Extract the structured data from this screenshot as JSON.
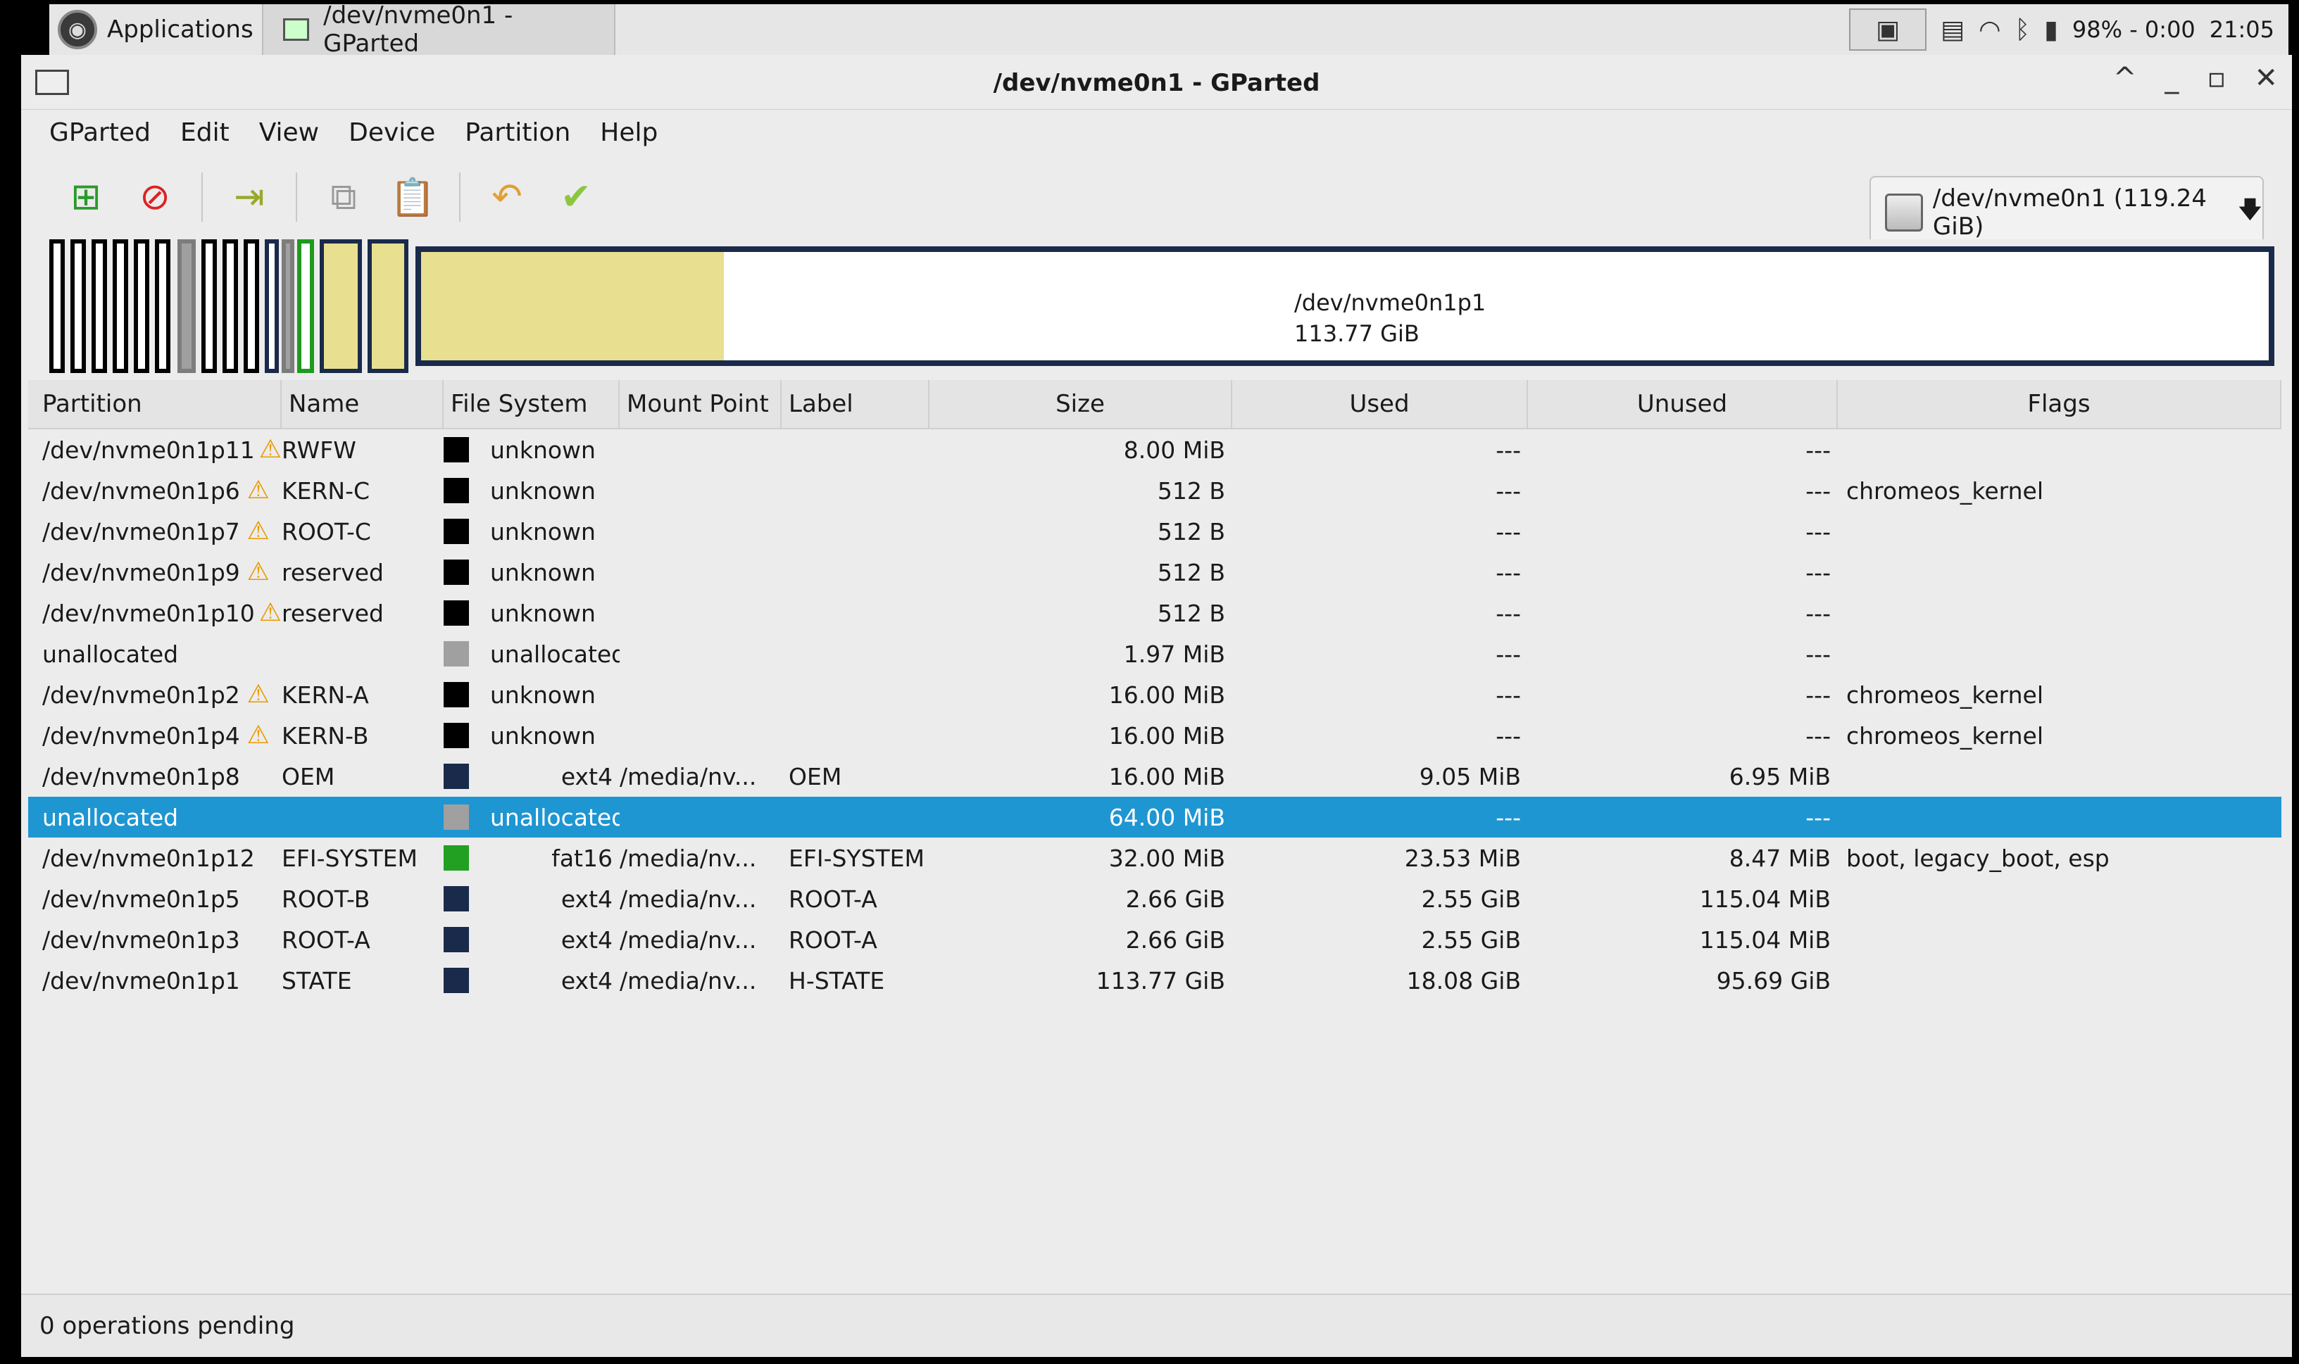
{
  "panel": {
    "applications_label": "Applications",
    "task_label": "/dev/nvme0n1 - GParted",
    "battery_text": "98% - 0:00",
    "clock": "21:05"
  },
  "window": {
    "title": "/dev/nvme0n1 - GParted",
    "controls": {
      "minimize": "_",
      "maximize": "▫",
      "close": "✕",
      "up": "^"
    }
  },
  "menu": [
    "GParted",
    "Edit",
    "View",
    "Device",
    "Partition",
    "Help"
  ],
  "device_selector": {
    "label": "/dev/nvme0n1 (119.24 GiB)"
  },
  "graph": {
    "main_partition": "/dev/nvme0n1p1",
    "main_size": "113.77 GiB"
  },
  "columns": {
    "partition": "Partition",
    "name": "Name",
    "filesystem": "File System",
    "mount": "Mount Point",
    "label": "Label",
    "size": "Size",
    "used": "Used",
    "unused": "Unused",
    "flags": "Flags"
  },
  "colors": {
    "unknown": "#000000",
    "unallocated": "#a0a0a0",
    "ext4": "#1a2a4a",
    "fat16": "#22a022",
    "selection": "#1e96d2",
    "used_space": "#e8df90"
  },
  "rows": [
    {
      "partition": "/dev/nvme0n1p11",
      "warn": true,
      "name": "RWFW",
      "fs": "unknown",
      "fs_color": "#000000",
      "mount": "",
      "label": "",
      "size": "8.00 MiB",
      "used": "---",
      "unused": "---",
      "flags": ""
    },
    {
      "partition": "/dev/nvme0n1p6",
      "warn": true,
      "name": "KERN-C",
      "fs": "unknown",
      "fs_color": "#000000",
      "mount": "",
      "label": "",
      "size": "512 B",
      "used": "---",
      "unused": "---",
      "flags": "chromeos_kernel"
    },
    {
      "partition": "/dev/nvme0n1p7",
      "warn": true,
      "name": "ROOT-C",
      "fs": "unknown",
      "fs_color": "#000000",
      "mount": "",
      "label": "",
      "size": "512 B",
      "used": "---",
      "unused": "---",
      "flags": ""
    },
    {
      "partition": "/dev/nvme0n1p9",
      "warn": true,
      "name": "reserved",
      "fs": "unknown",
      "fs_color": "#000000",
      "mount": "",
      "label": "",
      "size": "512 B",
      "used": "---",
      "unused": "---",
      "flags": ""
    },
    {
      "partition": "/dev/nvme0n1p10",
      "warn": true,
      "name": "reserved",
      "fs": "unknown",
      "fs_color": "#000000",
      "mount": "",
      "label": "",
      "size": "512 B",
      "used": "---",
      "unused": "---",
      "flags": ""
    },
    {
      "partition": "unallocated",
      "warn": false,
      "name": "",
      "fs": "unallocated",
      "fs_color": "#a0a0a0",
      "mount": "",
      "label": "",
      "size": "1.97 MiB",
      "used": "---",
      "unused": "---",
      "flags": ""
    },
    {
      "partition": "/dev/nvme0n1p2",
      "warn": true,
      "name": "KERN-A",
      "fs": "unknown",
      "fs_color": "#000000",
      "mount": "",
      "label": "",
      "size": "16.00 MiB",
      "used": "---",
      "unused": "---",
      "flags": "chromeos_kernel"
    },
    {
      "partition": "/dev/nvme0n1p4",
      "warn": true,
      "name": "KERN-B",
      "fs": "unknown",
      "fs_color": "#000000",
      "mount": "",
      "label": "",
      "size": "16.00 MiB",
      "used": "---",
      "unused": "---",
      "flags": "chromeos_kernel"
    },
    {
      "partition": "/dev/nvme0n1p8",
      "warn": false,
      "name": "OEM",
      "fs": "ext4",
      "fs_color": "#1a2a4a",
      "mount": "/media/nv...",
      "label": "OEM",
      "size": "16.00 MiB",
      "used": "9.05 MiB",
      "unused": "6.95 MiB",
      "flags": ""
    },
    {
      "partition": "unallocated",
      "warn": false,
      "name": "",
      "fs": "unallocated",
      "fs_color": "#a0a0a0",
      "mount": "",
      "label": "",
      "size": "64.00 MiB",
      "used": "---",
      "unused": "---",
      "flags": "",
      "selected": true
    },
    {
      "partition": "/dev/nvme0n1p12",
      "warn": false,
      "name": "EFI-SYSTEM",
      "fs": "fat16",
      "fs_color": "#22a022",
      "mount": "/media/nv...",
      "label": "EFI-SYSTEM",
      "size": "32.00 MiB",
      "used": "23.53 MiB",
      "unused": "8.47 MiB",
      "flags": "boot, legacy_boot, esp"
    },
    {
      "partition": "/dev/nvme0n1p5",
      "warn": false,
      "name": "ROOT-B",
      "fs": "ext4",
      "fs_color": "#1a2a4a",
      "mount": "/media/nv...",
      "label": "ROOT-A",
      "size": "2.66 GiB",
      "used": "2.55 GiB",
      "unused": "115.04 MiB",
      "flags": ""
    },
    {
      "partition": "/dev/nvme0n1p3",
      "warn": false,
      "name": "ROOT-A",
      "fs": "ext4",
      "fs_color": "#1a2a4a",
      "mount": "/media/nv...",
      "label": "ROOT-A",
      "size": "2.66 GiB",
      "used": "2.55 GiB",
      "unused": "115.04 MiB",
      "flags": ""
    },
    {
      "partition": "/dev/nvme0n1p1",
      "warn": false,
      "name": "STATE",
      "fs": "ext4",
      "fs_color": "#1a2a4a",
      "mount": "/media/nv...",
      "label": "H-STATE",
      "size": "113.77 GiB",
      "used": "18.08 GiB",
      "unused": "95.69 GiB",
      "flags": ""
    }
  ],
  "status": {
    "text": "0 operations pending"
  }
}
